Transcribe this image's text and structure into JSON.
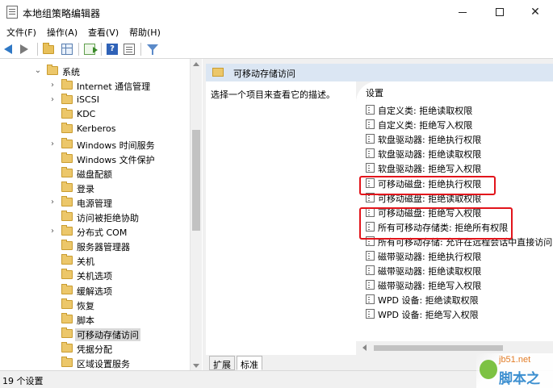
{
  "window": {
    "title": "本地组策略编辑器"
  },
  "menu": [
    "文件(F)",
    "操作(A)",
    "查看(V)",
    "帮助(H)"
  ],
  "tree": {
    "items": [
      {
        "label": "系统",
        "caret": "expanded",
        "indent": 0
      },
      {
        "label": "Internet 通信管理",
        "caret": "collapsed",
        "indent": 1
      },
      {
        "label": "iSCSI",
        "caret": "collapsed",
        "indent": 1
      },
      {
        "label": "KDC",
        "caret": "none",
        "indent": 1
      },
      {
        "label": "Kerberos",
        "caret": "none",
        "indent": 1
      },
      {
        "label": "Windows 时间服务",
        "caret": "collapsed",
        "indent": 1
      },
      {
        "label": "Windows 文件保护",
        "caret": "none",
        "indent": 1
      },
      {
        "label": "磁盘配额",
        "caret": "none",
        "indent": 1
      },
      {
        "label": "登录",
        "caret": "none",
        "indent": 1
      },
      {
        "label": "电源管理",
        "caret": "collapsed",
        "indent": 1
      },
      {
        "label": "访问被拒绝协助",
        "caret": "none",
        "indent": 1
      },
      {
        "label": "分布式 COM",
        "caret": "collapsed",
        "indent": 1
      },
      {
        "label": "服务器管理器",
        "caret": "none",
        "indent": 1
      },
      {
        "label": "关机",
        "caret": "none",
        "indent": 1
      },
      {
        "label": "关机选项",
        "caret": "none",
        "indent": 1
      },
      {
        "label": "缓解选项",
        "caret": "none",
        "indent": 1
      },
      {
        "label": "恢复",
        "caret": "none",
        "indent": 1
      },
      {
        "label": "脚本",
        "caret": "none",
        "indent": 1
      },
      {
        "label": "可移动存储访问",
        "caret": "none",
        "indent": 1,
        "selected": true
      },
      {
        "label": "凭据分配",
        "caret": "none",
        "indent": 1
      },
      {
        "label": "区域设置服务",
        "caret": "none",
        "indent": 1
      }
    ]
  },
  "right": {
    "header": "可移动存储访问",
    "description": "选择一个项目来查看它的描述。",
    "column_header": "设置",
    "settings": [
      "自定义类: 拒绝读取权限",
      "自定义类: 拒绝写入权限",
      "软盘驱动器: 拒绝执行权限",
      "软盘驱动器: 拒绝读取权限",
      "软盘驱动器: 拒绝写入权限",
      "可移动磁盘: 拒绝执行权限",
      "可移动磁盘: 拒绝读取权限",
      "可移动磁盘: 拒绝写入权限",
      "所有可移动存储类: 拒绝所有权限",
      "所有可移动存储: 允许在远程会话中直接访问",
      "磁带驱动器: 拒绝执行权限",
      "磁带驱动器: 拒绝读取权限",
      "磁带驱动器: 拒绝写入权限",
      "WPD 设备: 拒绝读取权限",
      "WPD 设备: 拒绝写入权限"
    ],
    "tabs": [
      "扩展",
      "标准"
    ]
  },
  "status": "19 个设置",
  "watermark": {
    "url": "jb51.net",
    "name": "脚本之家"
  },
  "colors": {
    "highlight": "#e2141b",
    "header_bg": "#dbe6f3",
    "selected_bg": "#d9d9d9"
  }
}
